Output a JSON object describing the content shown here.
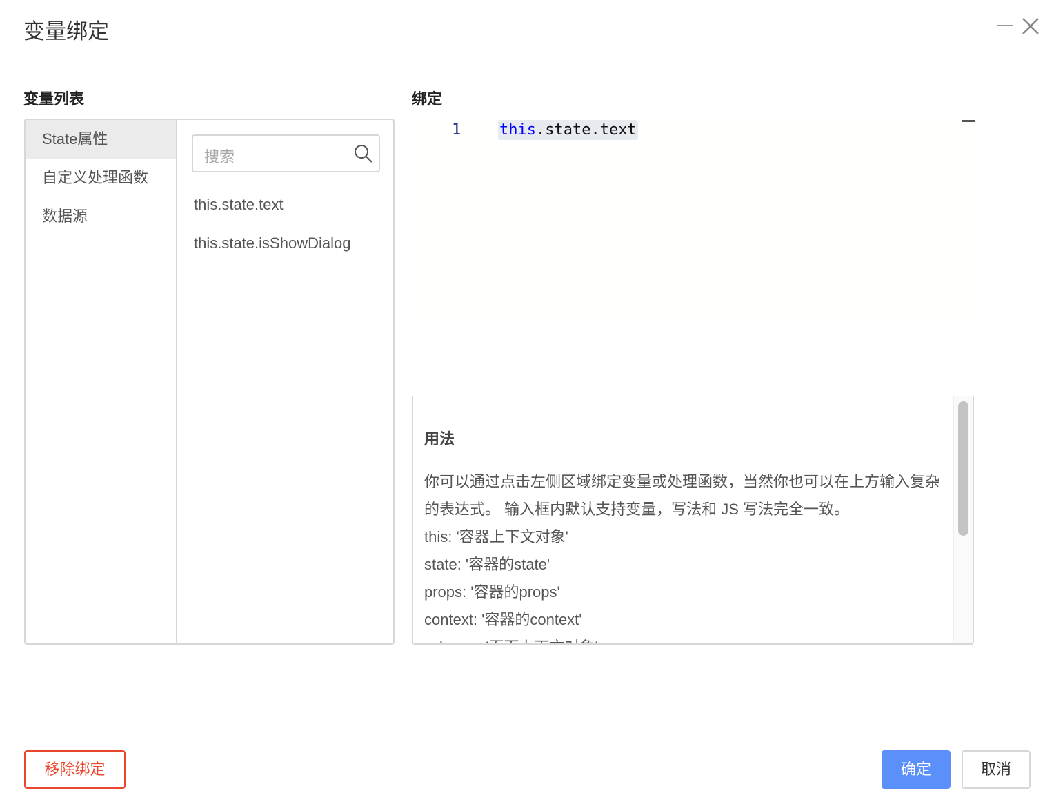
{
  "dialog": {
    "title": "变量绑定",
    "minimize_icon": "minus-icon",
    "close_icon": "close-icon"
  },
  "variables": {
    "heading": "变量列表",
    "categories": [
      "State属性",
      "自定义处理函数",
      "数据源"
    ],
    "active_category": "State属性",
    "search_placeholder": "搜索",
    "items": [
      "this.state.text",
      "this.state.isShowDialog"
    ]
  },
  "binding": {
    "heading": "绑定",
    "line_number": "1",
    "code_keyword": "this",
    "code_rest": ".state.text"
  },
  "usage": {
    "heading": "用法",
    "lines": [
      "你可以通过点击左侧区域绑定变量或处理函数，当然你也可以在上方输入复杂的表达式。 输入框内默认支持变量，写法和 JS 写法完全一致。",
      "this: '容器上下文对象'",
      "state: '容器的state'",
      "props: '容器的props'",
      "context: '容器的context'",
      "schema: '页面上下文对象'"
    ]
  },
  "footer": {
    "remove": "移除绑定",
    "confirm": "确定",
    "cancel": "取消"
  },
  "colors": {
    "primary": "#5b8ff9",
    "danger": "#e8472e",
    "keyword": "#0000ff"
  }
}
